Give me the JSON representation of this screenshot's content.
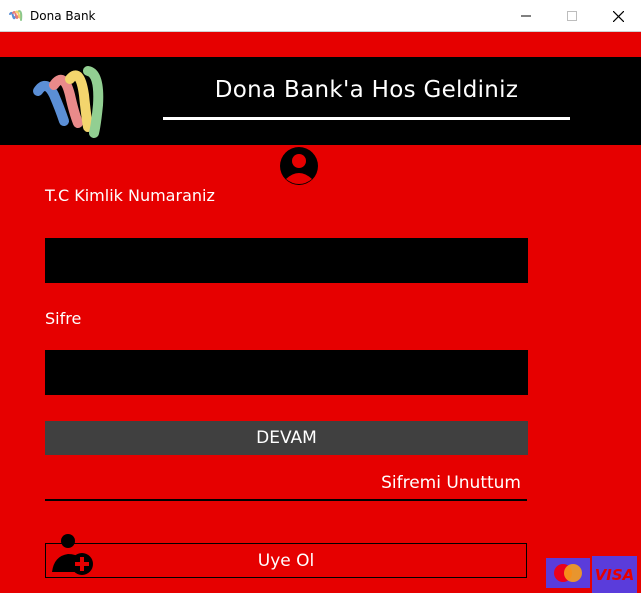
{
  "window": {
    "title": "Dona Bank"
  },
  "header": {
    "welcome": "Dona Bank'a Hos Geldiniz"
  },
  "form": {
    "tc_label": "T.C Kimlik Numaraniz",
    "tc_value": "",
    "password_label": "Sifre",
    "password_value": "",
    "submit_label": "DEVAM",
    "forgot_label": "Sifremi Unuttum",
    "register_label": "Uye Ol"
  },
  "payment": {
    "visa_label": "VISA"
  },
  "colors": {
    "background": "#e60000",
    "header": "#000000",
    "button": "#404040",
    "card_bg": "#5a3cdb",
    "mastercard_red": "#eb001b",
    "mastercard_yellow": "#f79e1b"
  },
  "icons": {
    "app": "dona-logo-icon",
    "user": "user-circle-icon",
    "add_user": "add-user-icon",
    "minimize": "minimize-icon",
    "maximize": "maximize-icon",
    "close": "close-icon"
  }
}
